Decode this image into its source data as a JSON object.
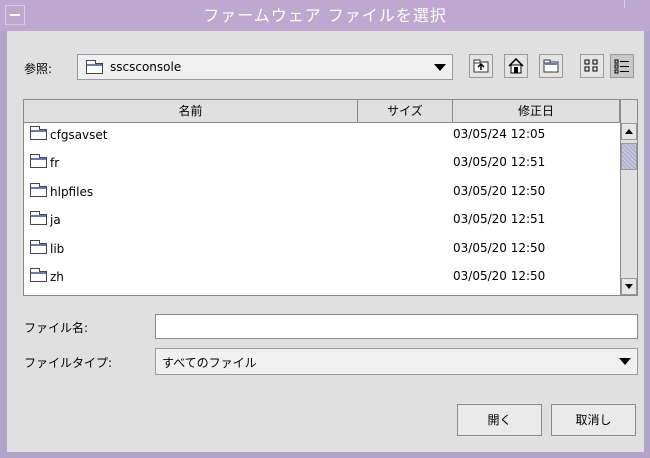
{
  "window": {
    "title": "ファームウェア ファイルを選択"
  },
  "lookin": {
    "label": "参照:",
    "value": "sscsconsole"
  },
  "toolbar": {
    "icons": [
      "up-folder-icon",
      "home-icon",
      "new-folder-icon",
      "list-view-icon",
      "details-view-icon"
    ],
    "selected": "details-view-icon"
  },
  "table": {
    "columns": [
      "名前",
      "サイズ",
      "修正日"
    ],
    "rows": [
      {
        "name": "cfgsavset",
        "size": "",
        "modified": "03/05/24 12:05"
      },
      {
        "name": "fr",
        "size": "",
        "modified": "03/05/20 12:51"
      },
      {
        "name": "hlpfiles",
        "size": "",
        "modified": "03/05/20 12:50"
      },
      {
        "name": "ja",
        "size": "",
        "modified": "03/05/20 12:51"
      },
      {
        "name": "lib",
        "size": "",
        "modified": "03/05/20 12:50"
      },
      {
        "name": "zh",
        "size": "",
        "modified": "03/05/20 12:50"
      }
    ]
  },
  "filename": {
    "label": "ファイル名:",
    "value": ""
  },
  "filetype": {
    "label": "ファイルタイプ:",
    "value": "すべてのファイル"
  },
  "buttons": {
    "open": "開く",
    "cancel": "取消し"
  },
  "colors": {
    "titlebar": "#bfa8d0",
    "frame": "#b0a4c8",
    "panel": "#e0e0e0"
  }
}
